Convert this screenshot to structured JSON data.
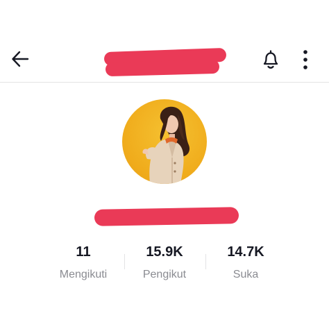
{
  "header": {
    "back_icon": "arrow-left-icon",
    "notification_icon": "bell-icon",
    "more_icon": "more-vertical-icon"
  },
  "profile": {
    "avatar": "profile-photo-avatar",
    "redaction_color": "#ea3a57"
  },
  "stats": [
    {
      "value": "11",
      "label": "Mengikuti"
    },
    {
      "value": "15.9K",
      "label": "Pengikut"
    },
    {
      "value": "14.7K",
      "label": "Suka"
    }
  ]
}
